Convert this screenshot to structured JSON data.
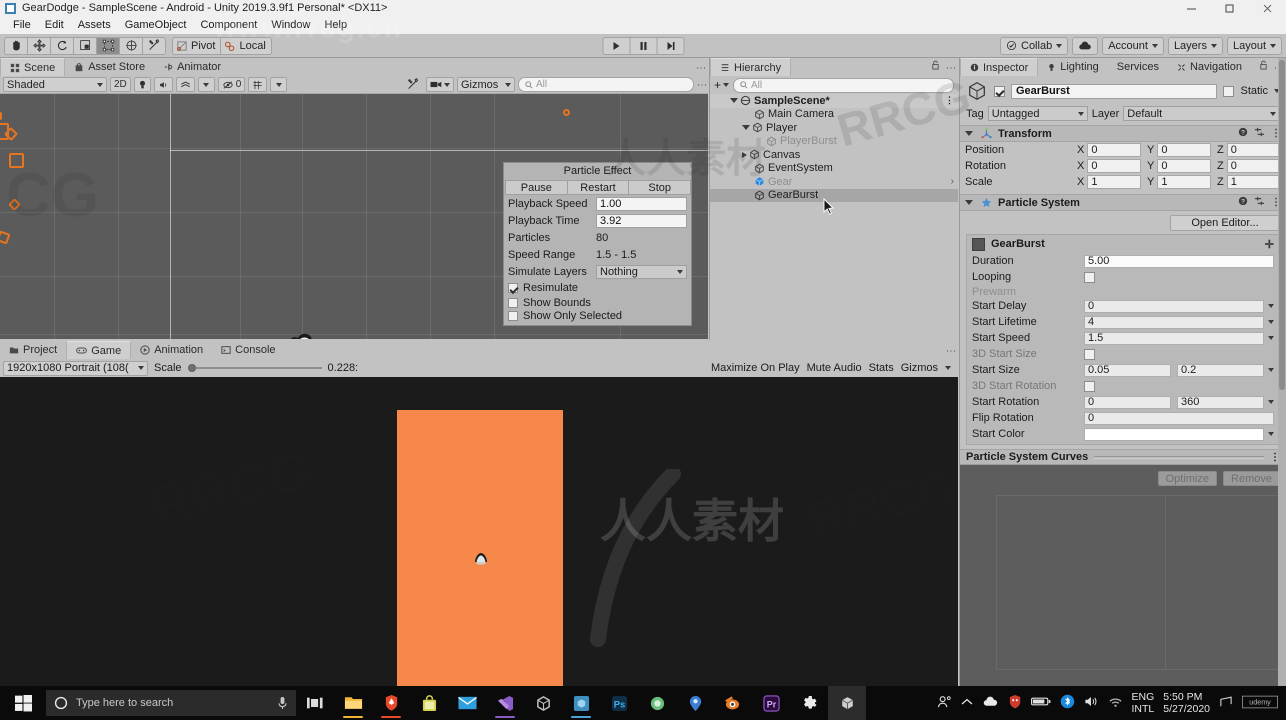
{
  "window": {
    "title": "GearDodge - SampleScene - Android - Unity 2019.3.9f1 Personal* <DX11>",
    "minimize": "minimize-icon",
    "maximize": "maximize-icon",
    "close": "close-icon"
  },
  "menu": {
    "items": [
      "File",
      "Edit",
      "Assets",
      "GameObject",
      "Component",
      "Window",
      "Help"
    ]
  },
  "toolbar": {
    "tools": [
      "hand-tool",
      "move-tool",
      "rotate-tool",
      "scale-tool",
      "rect-tool",
      "transform-tool",
      "custom-tool"
    ],
    "active_tool_index": 4,
    "pivot_label": "Pivot",
    "local_label": "Local",
    "play_label": "play",
    "pause_label": "pause",
    "step_label": "step",
    "collab_label": "Collab",
    "cloud_label": "cloud-icon",
    "account_label": "Account",
    "layers_label": "Layers",
    "layout_label": "Layout"
  },
  "scene": {
    "tabs": [
      {
        "label": "Scene",
        "icon": "scene-icon",
        "active": true
      },
      {
        "label": "Asset Store",
        "icon": "store-icon",
        "active": false
      },
      {
        "label": "Animator",
        "icon": "animator-icon",
        "active": false
      }
    ],
    "shading_mode": "Shaded",
    "twod_label": "2D",
    "light_icon": "lighting-toggle-icon",
    "audio_icon": "audio-toggle-icon",
    "fx_icon": "effects-icon",
    "hidden_count": "0",
    "grid_icon": "grid-icon",
    "gizmos_label": "Gizmos",
    "search_placeholder": "All"
  },
  "particle_effect": {
    "title": "Particle Effect",
    "buttons": [
      "Pause",
      "Restart",
      "Stop"
    ],
    "rows": [
      {
        "label": "Playback Speed",
        "value": "1.00",
        "type": "field"
      },
      {
        "label": "Playback Time",
        "value": "3.92",
        "type": "field"
      },
      {
        "label": "Particles",
        "value": "80",
        "type": "text"
      },
      {
        "label": "Speed Range",
        "value": "1.5 - 1.5",
        "type": "text"
      },
      {
        "label": "Simulate Layers",
        "value": "Nothing",
        "type": "dropdown"
      }
    ],
    "checkboxes": [
      {
        "label": "Resimulate",
        "checked": true
      },
      {
        "label": "Show Bounds",
        "checked": false
      },
      {
        "label": "Show Only Selected",
        "checked": false
      }
    ]
  },
  "hierarchy": {
    "tab_label": "Hierarchy",
    "tab_icon": "hierarchy-icon",
    "add_label": "+",
    "search_placeholder": "All",
    "items": [
      {
        "label": "SampleScene*",
        "depth": 0,
        "icon": "scene-icon",
        "expanded": true,
        "dim": false,
        "selected": false,
        "is_scene": true
      },
      {
        "label": "Main Camera",
        "depth": 1,
        "icon": "gameobject-icon",
        "expanded": null,
        "dim": false,
        "selected": false
      },
      {
        "label": "Player",
        "depth": 1,
        "icon": "gameobject-icon",
        "expanded": true,
        "dim": false,
        "selected": false
      },
      {
        "label": "PlayerBurst",
        "depth": 2,
        "icon": "gameobject-icon",
        "expanded": null,
        "dim": true,
        "selected": false
      },
      {
        "label": "Canvas",
        "depth": 1,
        "icon": "gameobject-icon",
        "expanded": false,
        "dim": false,
        "selected": false
      },
      {
        "label": "EventSystem",
        "depth": 1,
        "icon": "gameobject-icon",
        "expanded": null,
        "dim": false,
        "selected": false
      },
      {
        "label": "Gear",
        "depth": 1,
        "icon": "prefab-icon",
        "expanded": null,
        "dim": true,
        "selected": false,
        "has_arrow": true
      },
      {
        "label": "GearBurst",
        "depth": 1,
        "icon": "gameobject-icon",
        "expanded": null,
        "dim": false,
        "selected": true
      }
    ]
  },
  "inspector": {
    "tabs": [
      {
        "label": "Inspector",
        "icon": "inspector-icon",
        "active": true
      },
      {
        "label": "Lighting",
        "icon": "lighting-icon",
        "active": false
      },
      {
        "label": "Services",
        "icon": "services-icon",
        "active": false
      },
      {
        "label": "Navigation",
        "icon": "navigation-icon",
        "active": false
      }
    ],
    "object_name": "GearBurst",
    "object_enabled": true,
    "static_label": "Static",
    "tag_label": "Tag",
    "tag_value": "Untagged",
    "layer_label": "Layer",
    "layer_value": "Default",
    "transform": {
      "title": "Transform",
      "rows": [
        {
          "label": "Position",
          "x": "0",
          "y": "0",
          "z": "0"
        },
        {
          "label": "Rotation",
          "x": "0",
          "y": "0",
          "z": "0"
        },
        {
          "label": "Scale",
          "x": "1",
          "y": "1",
          "z": "1"
        }
      ],
      "axis_labels": [
        "X",
        "Y",
        "Z"
      ]
    },
    "particle_system": {
      "title": "Particle System",
      "open_editor_label": "Open Editor...",
      "module_name": "GearBurst",
      "properties": [
        {
          "label": "Duration",
          "value": "5.00",
          "type": "field",
          "dropdown": false
        },
        {
          "label": "Looping",
          "value": "",
          "type": "checkbox",
          "dropdown": false
        },
        {
          "label": "Prewarm",
          "value": "",
          "type": "disabled",
          "dropdown": false
        },
        {
          "label": "Start Delay",
          "value": "0",
          "type": "field",
          "dropdown": true
        },
        {
          "label": "Start Lifetime",
          "value": "4",
          "type": "field",
          "dropdown": true
        },
        {
          "label": "Start Speed",
          "value": "1.5",
          "type": "field",
          "dropdown": true
        },
        {
          "label": "3D Start Size",
          "value": "",
          "type": "checkbox",
          "dropdown": false
        },
        {
          "label": "Start Size",
          "value": "0.05",
          "value2": "0.2",
          "type": "field2",
          "dropdown": true
        },
        {
          "label": "3D Start Rotation",
          "value": "",
          "type": "checkbox",
          "dropdown": false
        },
        {
          "label": "Start Rotation",
          "value": "0",
          "value2": "360",
          "type": "field2",
          "dropdown": true
        },
        {
          "label": "Flip Rotation",
          "value": "0",
          "type": "field",
          "dropdown": false
        },
        {
          "label": "Start Color",
          "value": "",
          "type": "color",
          "dropdown": true
        }
      ]
    },
    "curves": {
      "title": "Particle System Curves",
      "optimize_label": "Optimize",
      "remove_label": "Remove"
    }
  },
  "game": {
    "tabs": [
      {
        "label": "Project",
        "icon": "project-icon",
        "active": false
      },
      {
        "label": "Game",
        "icon": "game-icon",
        "active": true
      },
      {
        "label": "Animation",
        "icon": "animation-icon",
        "active": false
      },
      {
        "label": "Console",
        "icon": "console-icon",
        "active": false
      }
    ],
    "resolution": "1920x1080 Portrait (108(",
    "scale_label": "Scale",
    "scale_value": "0.228:",
    "maximize_label": "Maximize On Play",
    "mute_label": "Mute Audio",
    "stats_label": "Stats",
    "gizmos_label": "Gizmos",
    "background_color": "#f5884a"
  },
  "taskbar": {
    "start_icon": "windows-start-icon",
    "search_placeholder": "Type here to search",
    "mic_icon": "microphone-icon",
    "taskview_icon": "task-view-icon",
    "apps": [
      {
        "name": "file-explorer-icon",
        "color": "#f2b33d",
        "underline": "#f2b33d"
      },
      {
        "name": "brave-browser-icon",
        "color": "#e8492b",
        "underline": "#e8492b"
      },
      {
        "name": "store-icon",
        "color": "#d6d14a",
        "underline": ""
      },
      {
        "name": "mail-icon",
        "color": "#2f9fe0",
        "underline": ""
      },
      {
        "name": "visual-studio-icon",
        "color": "#8b5cc7",
        "underline": "#8b5cc7"
      },
      {
        "name": "unity-hub-icon",
        "color": "#bcbcbc",
        "underline": ""
      },
      {
        "name": "unity-icon",
        "color": "#49a6d4",
        "underline": "#49a6d4"
      },
      {
        "name": "photoshop-icon",
        "color": "#2e6fa8",
        "underline": ""
      },
      {
        "name": "aseprite-icon",
        "color": "#6bbd7a",
        "underline": ""
      },
      {
        "name": "maps-icon",
        "color": "#3b7fd4",
        "underline": ""
      },
      {
        "name": "blender-icon",
        "color": "#e87d28",
        "underline": ""
      },
      {
        "name": "premiere-icon",
        "color": "#9a5ad0",
        "underline": ""
      },
      {
        "name": "settings-icon",
        "color": "#e8e8e8",
        "underline": ""
      },
      {
        "name": "unity-editor-icon",
        "color": "#cccccc",
        "underline": "",
        "active": true
      }
    ],
    "tray": {
      "people_icon": "people-icon",
      "chevron_icon": "show-hidden-icons-icon",
      "onedrive_icon": "onedrive-icon",
      "antivirus_icon": "antivirus-icon",
      "battery_icon": "battery-icon",
      "bluetooth_icon": "bluetooth-icon",
      "volume_icon": "volume-icon",
      "wifi_icon": "wifi-icon",
      "language_line1": "ENG",
      "language_line2": "INTL",
      "time": "5:50 PM",
      "date": "5/27/2020"
    }
  },
  "watermarks": {
    "top": "www.rrcg.cn",
    "left": "CG",
    "center_left": "RRCG",
    "center": "人人素材",
    "right": "RRCG"
  }
}
